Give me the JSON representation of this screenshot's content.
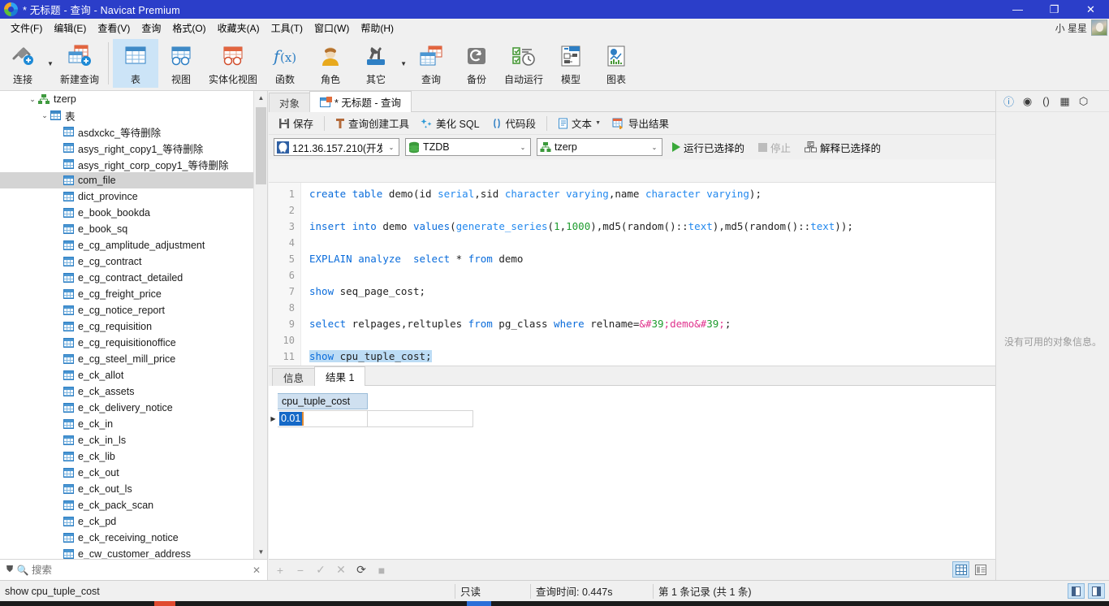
{
  "window": {
    "title_prefix": "* 无标题",
    "title_mid": "查询",
    "title_app": "Navicat Premium",
    "title_full": "* 无标题 - 查询 - Navicat Premium",
    "minimize": "—",
    "maximize": "❐",
    "close": "✕",
    "accent": "#2b3ec9"
  },
  "menubar": {
    "items": [
      {
        "label": "文件(F)",
        "name": "menu-file"
      },
      {
        "label": "编辑(E)",
        "name": "menu-edit"
      },
      {
        "label": "查看(V)",
        "name": "menu-view"
      },
      {
        "label": "查询",
        "name": "menu-query"
      },
      {
        "label": "格式(O)",
        "name": "menu-format"
      },
      {
        "label": "收藏夹(A)",
        "name": "menu-favorites"
      },
      {
        "label": "工具(T)",
        "name": "menu-tools"
      },
      {
        "label": "窗口(W)",
        "name": "menu-window"
      },
      {
        "label": "帮助(H)",
        "name": "menu-help"
      }
    ],
    "user_name": "小 星星"
  },
  "toolbar": {
    "items": [
      {
        "label": "连接",
        "icon": "connection-icon",
        "caret": true,
        "active": false
      },
      {
        "label": "新建查询",
        "icon": "new-query-icon",
        "caret": false,
        "active": false
      },
      {
        "label": "表",
        "icon": "table-icon",
        "caret": false,
        "active": true
      },
      {
        "label": "视图",
        "icon": "view-icon",
        "caret": false,
        "active": false
      },
      {
        "label": "实体化视图",
        "icon": "materialized-view-icon",
        "caret": false,
        "active": false
      },
      {
        "label": "函数",
        "icon": "function-icon",
        "caret": false,
        "active": false
      },
      {
        "label": "角色",
        "icon": "role-icon",
        "caret": false,
        "active": false
      },
      {
        "label": "其它",
        "icon": "other-icon",
        "caret": true,
        "active": false
      },
      {
        "label": "查询",
        "icon": "query-icon",
        "caret": false,
        "active": false
      },
      {
        "label": "备份",
        "icon": "backup-icon",
        "caret": false,
        "active": false
      },
      {
        "label": "自动运行",
        "icon": "automation-icon",
        "caret": false,
        "active": false
      },
      {
        "label": "模型",
        "icon": "model-icon",
        "caret": false,
        "active": false
      },
      {
        "label": "图表",
        "icon": "chart-icon",
        "caret": false,
        "active": false
      }
    ]
  },
  "sidebar": {
    "root": {
      "label": "tzerp",
      "expanded": true
    },
    "tables_folder": {
      "label": "表",
      "expanded": true
    },
    "selected": "com_file",
    "tables": [
      "asdxckc_等待删除",
      "asys_right_copy1_等待删除",
      "asys_right_corp_copy1_等待删除",
      "com_file",
      "dict_province",
      "e_book_bookda",
      "e_book_sq",
      "e_cg_amplitude_adjustment",
      "e_cg_contract",
      "e_cg_contract_detailed",
      "e_cg_freight_price",
      "e_cg_notice_report",
      "e_cg_requisition",
      "e_cg_requisitionoffice",
      "e_cg_steel_mill_price",
      "e_ck_allot",
      "e_ck_assets",
      "e_ck_delivery_notice",
      "e_ck_in",
      "e_ck_in_ls",
      "e_ck_lib",
      "e_ck_out",
      "e_ck_out_ls",
      "e_ck_pack_scan",
      "e_ck_pd",
      "e_ck_receiving_notice",
      "e_cw_customer_address"
    ],
    "search_placeholder": "搜索"
  },
  "tabs": {
    "object_tab": "对象",
    "query_tab": "* 无标题 - 查询"
  },
  "query_toolbar": {
    "save": "保存",
    "query_builder": "查询创建工具",
    "beautify_sql": "美化 SQL",
    "snippet": "代码段",
    "text": "文本",
    "export_result": "导出结果"
  },
  "connection_bar": {
    "host": "121.36.157.210(开发",
    "database": "TZDB",
    "schema": "tzerp",
    "run_selected": "运行已选择的",
    "stop": "停止",
    "explain_selected": "解释已选择的"
  },
  "editor": {
    "line_numbers": [
      "1",
      "2",
      "3",
      "4",
      "5",
      "6",
      "7",
      "8",
      "9",
      "10",
      "11"
    ],
    "lines": [
      "create table demo(id serial,sid character varying,name character varying);",
      "",
      "insert into demo values(generate_series(1,1000),md5(random()::text),md5(random()::text));",
      "",
      "EXPLAIN analyze  select * from demo",
      "",
      "show seq_page_cost;",
      "",
      "select relpages,reltuples from pg_class where relname='demo';",
      "",
      "show cpu_tuple_cost;"
    ],
    "highlighted_line": 11
  },
  "result_panel": {
    "tabs": [
      {
        "label": "信息",
        "active": false
      },
      {
        "label": "结果 1",
        "active": true
      }
    ],
    "columns": [
      "cpu_tuple_cost"
    ],
    "rows": [
      [
        "0.01"
      ]
    ],
    "selected_cell": "0.01"
  },
  "grid_toolbar": {
    "add": "+",
    "remove": "−",
    "confirm": "✓",
    "cancel": "✕",
    "refresh": "⟳",
    "stop": "■",
    "view_grid": "grid-view-icon",
    "view_form": "form-view-icon"
  },
  "right_panel": {
    "icons": [
      "info-icon",
      "preview-icon",
      "parentheses-icon",
      "structure-icon",
      "settings-icon"
    ],
    "message": "没有可用的对象信息。"
  },
  "statusbar": {
    "sql": "show cpu_tuple_cost",
    "mode": "只读",
    "query_time": "查询时间: 0.447s",
    "record_info": "第 1 条记录 (共 1 条)"
  }
}
